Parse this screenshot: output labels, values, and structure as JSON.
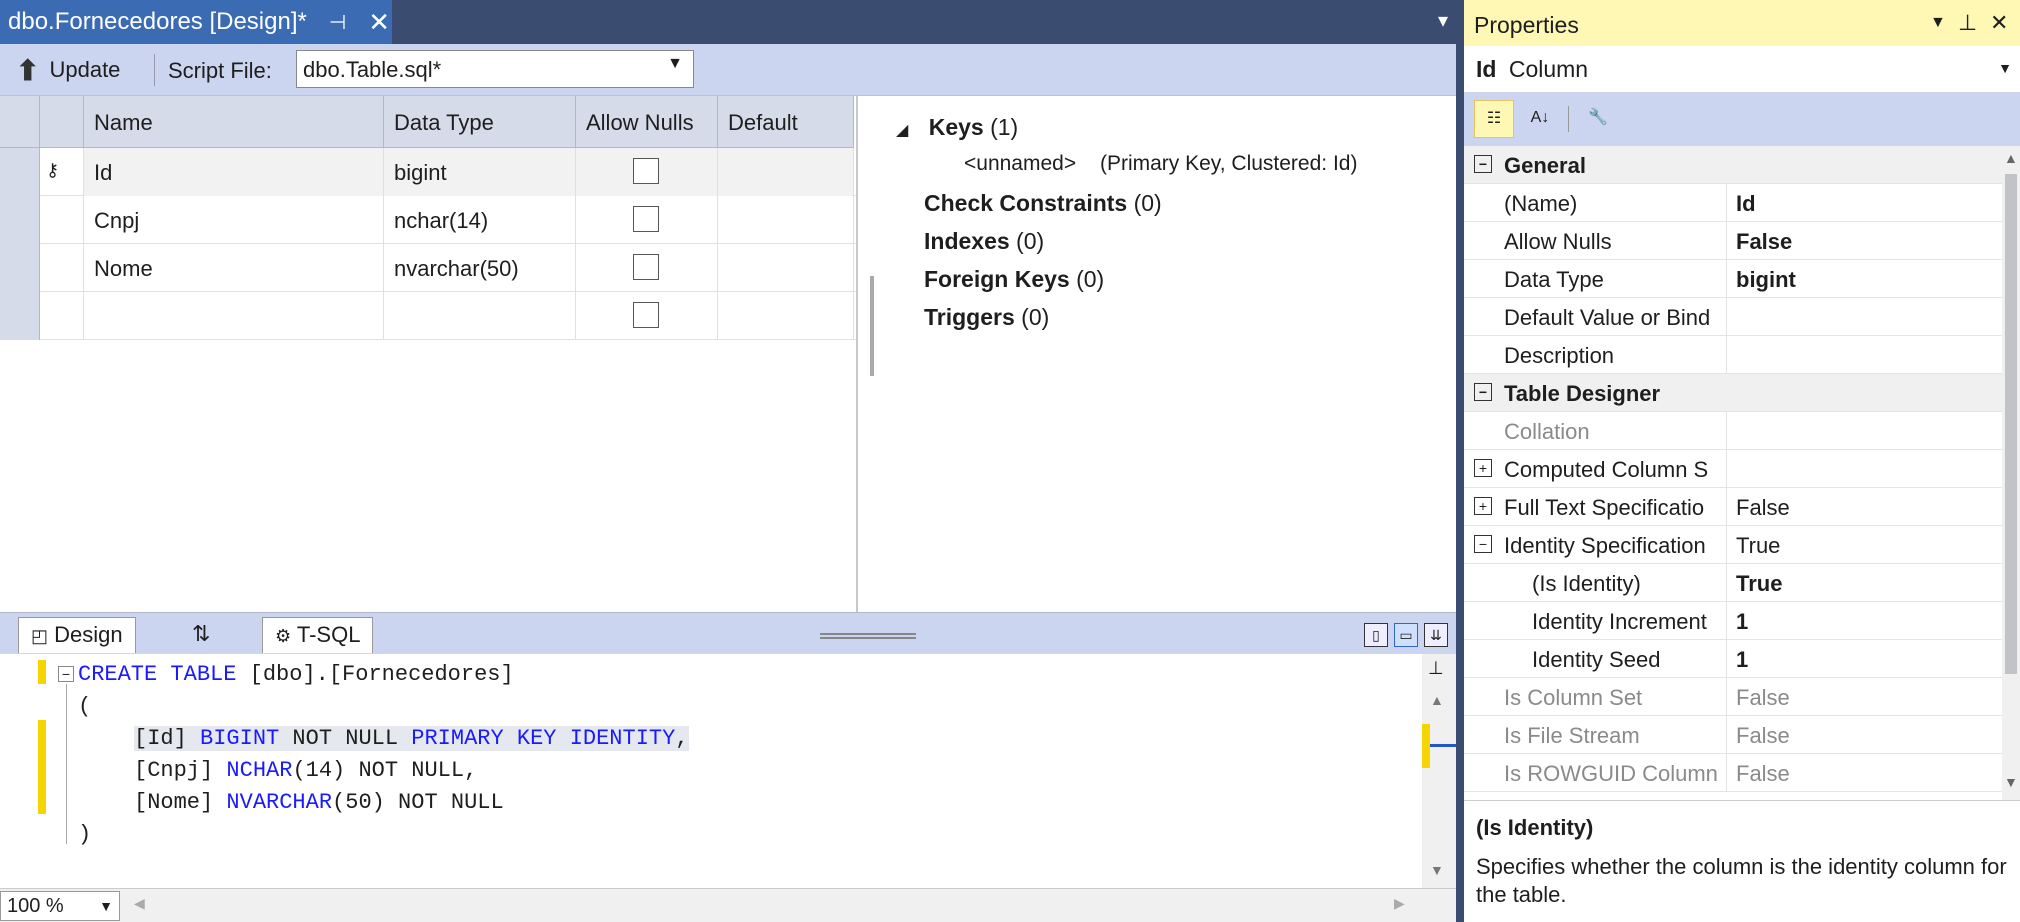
{
  "document": {
    "tab_title": "dbo.Fornecedores [Design]*",
    "pin_icon": "pin-icon",
    "close_icon": "close-icon"
  },
  "toolbar": {
    "update_label": "Update",
    "script_file_label": "Script File:",
    "script_file_value": "dbo.Table.sql*"
  },
  "grid": {
    "headers": [
      "Name",
      "Data Type",
      "Allow Nulls",
      "Default"
    ],
    "rows": [
      {
        "name": "Id",
        "type": "bigint",
        "allow_nulls": false,
        "primary_key": true
      },
      {
        "name": "Cnpj",
        "type": "nchar(14)",
        "allow_nulls": false
      },
      {
        "name": "Nome",
        "type": "nvarchar(50)",
        "allow_nulls": false
      },
      {
        "name": "",
        "type": "",
        "allow_nulls": false
      }
    ]
  },
  "keys_panel": {
    "keys_label": "Keys",
    "keys_count": "(1)",
    "key_name": "<unnamed>",
    "key_desc": "(Primary Key, Clustered: Id)",
    "check_label": "Check Constraints",
    "check_count": "(0)",
    "indexes_label": "Indexes",
    "indexes_count": "(0)",
    "fk_label": "Foreign Keys",
    "fk_count": "(0)",
    "triggers_label": "Triggers",
    "triggers_count": "(0)"
  },
  "bottom_tabs": {
    "design": "Design",
    "tsql": "T-SQL"
  },
  "editor": {
    "line1_kw": "CREATE TABLE",
    "line1_rest": " [dbo].[Fornecedores]",
    "line2": "(",
    "line3_a": "[Id] ",
    "line3_kw": "BIGINT",
    "line3_b": " NOT NULL ",
    "line3_kw2": "PRIMARY KEY IDENTITY",
    "line3_c": ",",
    "line4_a": "[Cnpj] ",
    "line4_kw": "NCHAR",
    "line4_b": "(14) NOT NULL,",
    "line5_a": "[Nome] ",
    "line5_kw": "NVARCHAR",
    "line5_b": "(50) NOT NULL",
    "line6": ")"
  },
  "status": {
    "zoom": "100 %"
  },
  "properties": {
    "title": "Properties",
    "object_name": "Id",
    "object_type": "Column",
    "rows": [
      {
        "kind": "cat",
        "name": "General"
      },
      {
        "kind": "prop",
        "name": "(Name)",
        "value": "Id",
        "bold": true
      },
      {
        "kind": "prop",
        "name": "Allow Nulls",
        "value": "False",
        "bold": true
      },
      {
        "kind": "prop",
        "name": "Data Type",
        "value": "bigint",
        "bold": true
      },
      {
        "kind": "prop",
        "name": "Default Value or Bind",
        "value": ""
      },
      {
        "kind": "prop",
        "name": "Description",
        "value": ""
      },
      {
        "kind": "cat",
        "name": "Table Designer"
      },
      {
        "kind": "prop",
        "name": "Collation",
        "value": "",
        "dim": true
      },
      {
        "kind": "exp",
        "name": "Computed Column S",
        "value": ""
      },
      {
        "kind": "exp",
        "name": "Full Text Specificatio",
        "value": "False"
      },
      {
        "kind": "col",
        "name": "Identity Specification",
        "value": "True"
      },
      {
        "kind": "sub",
        "name": "(Is Identity)",
        "value": "True",
        "bold": true
      },
      {
        "kind": "sub",
        "name": "Identity Increment",
        "value": "1",
        "bold": true
      },
      {
        "kind": "sub",
        "name": "Identity Seed",
        "value": "1",
        "bold": true
      },
      {
        "kind": "prop",
        "name": "Is Column Set",
        "value": "False",
        "dim": true
      },
      {
        "kind": "prop",
        "name": "Is File Stream",
        "value": "False",
        "dim": true
      },
      {
        "kind": "prop",
        "name": "Is ROWGUID Column",
        "value": "False",
        "dim": true
      }
    ],
    "desc_title": "(Is Identity)",
    "desc_text": "Specifies whether the column is the identity column for the table."
  }
}
